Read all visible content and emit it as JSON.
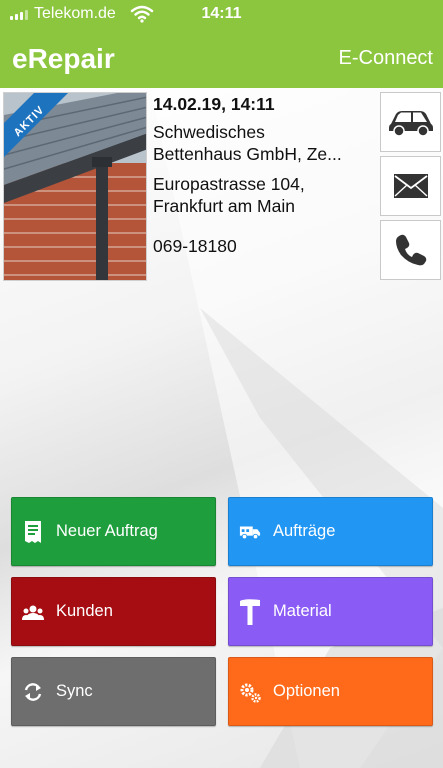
{
  "status_bar": {
    "carrier": "Telekom.de",
    "time": "14:11"
  },
  "header": {
    "title": "eRepair",
    "right_label": "E-Connect",
    "accent_color": "#8cc63f"
  },
  "order": {
    "badge": "AKTIV",
    "datetime": "14.02.19, 14:11",
    "company_line1": "Schwedisches",
    "company_line2": "Bettenhaus GmbH, Ze...",
    "street": "Europastrasse 104,",
    "city": "Frankfurt am Main",
    "phone": "069-18180"
  },
  "side_actions": [
    {
      "icon": "car-icon"
    },
    {
      "icon": "envelope-icon"
    },
    {
      "icon": "phone-icon"
    }
  ],
  "tiles": [
    {
      "label": "Neuer Auftrag",
      "icon": "receipt-icon",
      "color": "#1f9e3e"
    },
    {
      "label": "Aufträge",
      "icon": "truck-icon",
      "color": "#2196f3"
    },
    {
      "label": "Kunden",
      "icon": "users-icon",
      "color": "#a50d12"
    },
    {
      "label": "Material",
      "icon": "hammer-icon",
      "color": "#8a5cf5"
    },
    {
      "label": "Sync",
      "icon": "sync-icon",
      "color": "#6e6e6e"
    },
    {
      "label": "Optionen",
      "icon": "gears-icon",
      "color": "#ff6a1a"
    }
  ]
}
